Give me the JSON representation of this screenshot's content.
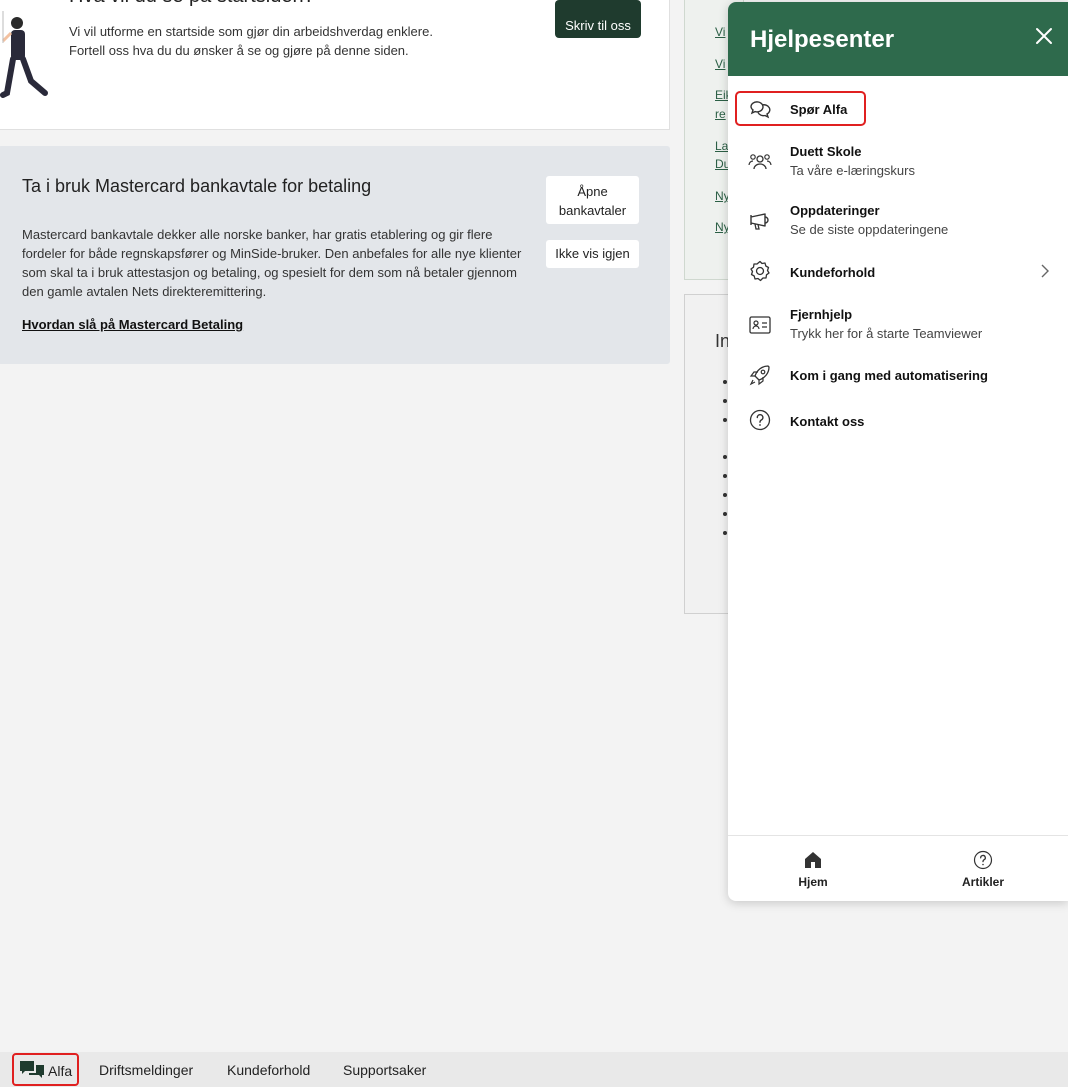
{
  "top_card": {
    "heading": "Hva vil du se på startsiden?",
    "line1": "Vi vil utforme en startside som gjør din arbeidshverdag enklere.",
    "line2": "Fortell oss hva du du ønsker å se og gjøre på denne siden.",
    "button": "Skriv til oss"
  },
  "mastercard": {
    "title": "Ta i bruk Mastercard bankavtale for betaling",
    "body": "Mastercard bankavtale dekker alle norske banker, har gratis etablering og gir flere fordeler for både regnskapsfører og MinSide-bruker. Den anbefales for alle nye klienter som skal ta i bruk attestasjon og betaling, og spesielt for dem som nå betaler gjennom den gamle avtalen Nets direkteremittering.",
    "link": "Hvordan slå på Mastercard Betaling",
    "open_button": "Åpne bankavtaler",
    "hide_button": "Ikke vis igjen"
  },
  "right_column": {
    "links": [
      "Vi",
      "Vi",
      "Eik",
      "re",
      "La",
      "Du",
      "Ny",
      "Ny"
    ],
    "card2_heading": "In"
  },
  "help_panel": {
    "title": "Hjelpesenter",
    "items": [
      {
        "title": "Spør Alfa",
        "subtitle": "",
        "icon": "chat-bubbles-icon"
      },
      {
        "title": "Duett Skole",
        "subtitle": "Ta våre e-læringskurs",
        "icon": "people-icon"
      },
      {
        "title": "Oppdateringer",
        "subtitle": "Se de siste oppdateringene",
        "icon": "megaphone-icon"
      },
      {
        "title": "Kundeforhold",
        "subtitle": "",
        "icon": "gear-icon"
      },
      {
        "title": "Fjernhjelp",
        "subtitle": "Trykk her for å starte Teamviewer",
        "icon": "id-card-icon"
      },
      {
        "title": "Kom i gang med automatisering",
        "subtitle": "",
        "icon": "rocket-icon"
      },
      {
        "title": "Kontakt oss",
        "subtitle": "",
        "icon": "question-circle-icon"
      }
    ],
    "footer_tabs": [
      {
        "label": "Hjem",
        "icon": "home-icon"
      },
      {
        "label": "Artikler",
        "icon": "question-circle-icon"
      }
    ],
    "accent_color": "#2e6a4c"
  },
  "bottom_bar": {
    "alfa_label": "Alfa",
    "items": [
      "Driftsmeldinger",
      "Kundeforhold",
      "Supportsaker"
    ]
  }
}
